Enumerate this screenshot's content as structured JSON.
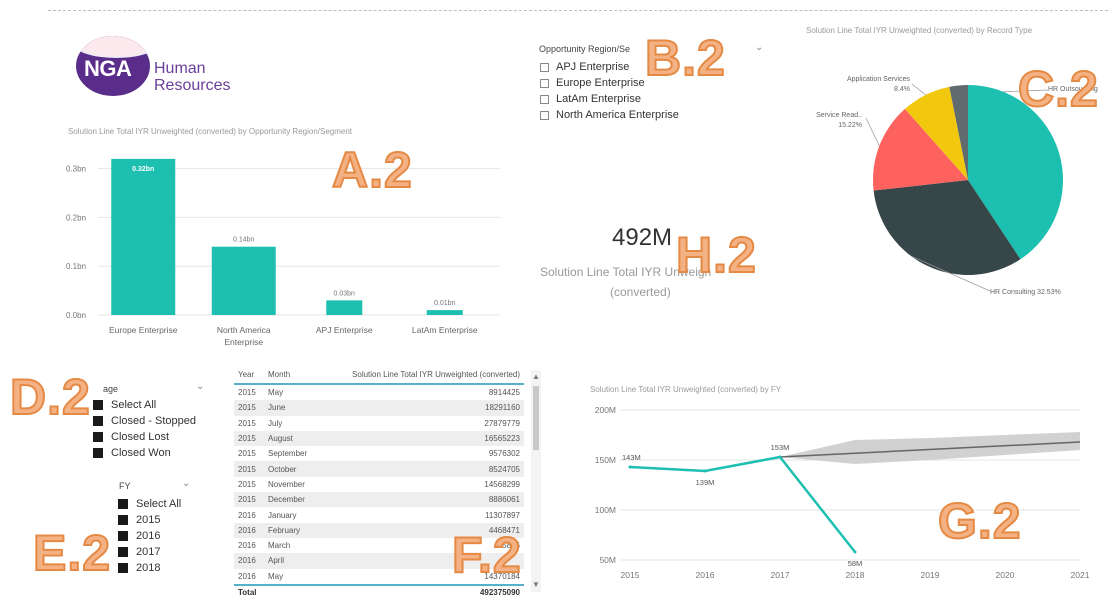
{
  "logo": {
    "initials": "NGA",
    "line1": "Human",
    "line2": "Resources"
  },
  "tags": {
    "a": "A.2",
    "b": "B.2",
    "c": "C.2",
    "d": "D.2",
    "e": "E.2",
    "f": "F.2",
    "g": "G.2",
    "h": "H.2"
  },
  "region_slicer": {
    "header": "Opportunity Region/Se",
    "items": [
      "APJ Enterprise",
      "Europe Enterprise",
      "LatAm Enterprise",
      "North America Enterprise"
    ]
  },
  "stage_slicer": {
    "header": "age",
    "items": [
      "Select All",
      "Closed - Stopped",
      "Closed Lost",
      "Closed Won"
    ]
  },
  "fy_slicer": {
    "header": "FY",
    "items": [
      "Select All",
      "2015",
      "2016",
      "2017",
      "2018"
    ]
  },
  "card": {
    "value": "492M",
    "label_line1": "Solution Line Total IYR Unweigh",
    "label_line2": "(converted)"
  },
  "table": {
    "headers": [
      "Year",
      "Month",
      "Solution Line Total IYR Unweighted (converted)"
    ],
    "rows": [
      [
        "2015",
        "May",
        "8914425"
      ],
      [
        "2015",
        "June",
        "18291160"
      ],
      [
        "2015",
        "July",
        "27879779"
      ],
      [
        "2015",
        "August",
        "16565223"
      ],
      [
        "2015",
        "September",
        "9576302"
      ],
      [
        "2015",
        "October",
        "8524705"
      ],
      [
        "2015",
        "November",
        "14568299"
      ],
      [
        "2015",
        "December",
        "8886061"
      ],
      [
        "2016",
        "January",
        "11307897"
      ],
      [
        "2016",
        "February",
        "4468471"
      ],
      [
        "2016",
        "March",
        "5896"
      ],
      [
        "2016",
        "April",
        ""
      ],
      [
        "2016",
        "May",
        "14370184"
      ]
    ],
    "total_label": "Total",
    "total_value": "492375090"
  },
  "chart_data": [
    {
      "type": "bar",
      "title": "Solution Line Total IYR Unweighted (converted) by Opportunity Region/Segment",
      "categories": [
        "Europe Enterprise",
        "North America Enterprise",
        "APJ Enterprise",
        "LatAm Enterprise"
      ],
      "category_lines": [
        [
          "Europe Enterprise"
        ],
        [
          "North America",
          "Enterprise"
        ],
        [
          "APJ Enterprise"
        ],
        [
          "LatAm Enterprise"
        ]
      ],
      "values": [
        0.32,
        0.14,
        0.03,
        0.01
      ],
      "data_labels": [
        "0.32bn",
        "0.14bn",
        "0.03bn",
        "0.01bn"
      ],
      "yticks": [
        "0.0bn",
        "0.1bn",
        "0.2bn",
        "0.3bn"
      ],
      "ylim": [
        0,
        0.33
      ],
      "color": "#1dbfb0"
    },
    {
      "type": "pie",
      "title": "Solution Line Total IYR Unweighted (converted) by Record Type",
      "slices": [
        {
          "name": "HR Outsourcing",
          "label": "HR Outsourcing",
          "value": 40.7,
          "color": "#1dbfb0"
        },
        {
          "name": "HR Consulting",
          "label": "HR Consulting 32.53%",
          "value": 32.53,
          "color": "#374649"
        },
        {
          "name": "Service Read..",
          "label": "Service Read.. 15.22%",
          "value": 15.22,
          "color": "#fd625e"
        },
        {
          "name": "Application Services",
          "label": "Application Services 8.4%",
          "value": 8.4,
          "color": "#f2c80f"
        },
        {
          "name": "Other",
          "label": "",
          "value": 3.15,
          "color": "#5f6b6d"
        }
      ]
    },
    {
      "type": "line",
      "title": "Solution Line Total IYR Unweighted (converted) by FY",
      "x": [
        "2015",
        "2016",
        "2017",
        "2018",
        "2019",
        "2020",
        "2021"
      ],
      "series": [
        {
          "values": [
            143,
            139,
            153,
            58
          ],
          "data_labels": [
            "143M",
            "139M",
            "153M",
            "58M"
          ],
          "color": "#1dbfb0"
        }
      ],
      "forecast": {
        "x_from": "2017",
        "x_to": "2021",
        "start": 153,
        "end": 168,
        "band_low": [
          153,
          146,
          150,
          155,
          160
        ],
        "band_high": [
          153,
          170,
          172,
          175,
          178
        ],
        "color": "#666666"
      },
      "yticks": [
        "50M",
        "100M",
        "150M",
        "200M"
      ],
      "ylim": [
        50,
        200
      ]
    }
  ]
}
